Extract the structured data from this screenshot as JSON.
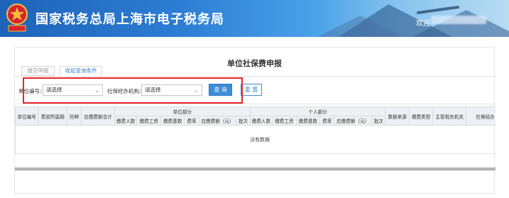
{
  "header": {
    "title": "国家税务总局上海市电子税务局",
    "welcome_text": "欢迎",
    "emblem_icon": "tax-emblem-icon",
    "colors": {
      "header_start": "#1e63b8",
      "header_end": "#b9dcf3"
    }
  },
  "page": {
    "title": "单位社保费申报",
    "tabs": [
      {
        "label": "提交申报",
        "active": false
      },
      {
        "label": "收起查询条件",
        "active": true
      }
    ]
  },
  "filters": {
    "unit_code_label": "单位编号：",
    "unit_code_value": "请选择",
    "agency_label": "社保经办机构：",
    "agency_value": "请选择",
    "search_label": "查 询",
    "reset_label": "重 置",
    "accent_color": "#3c8ed8",
    "highlight_color": "#e8262a"
  },
  "table": {
    "group_unit": "单位部分",
    "group_personal": "个人部分",
    "columns_left": [
      "单位编号",
      "费款所属期",
      "险种",
      "应缴费额合计"
    ],
    "columns_unit": [
      "缴费人数",
      "缴费工资",
      "缴费基数",
      "费率",
      "应缴费额（元）",
      "批次"
    ],
    "columns_personal": [
      "缴费人数",
      "缴费工资",
      "缴费基数",
      "费率",
      "应缴费额（元）",
      "批次"
    ],
    "columns_right": [
      "数据来源",
      "缴费类型",
      "主管税务机关",
      "社保经办"
    ],
    "empty_text": "没有数据"
  }
}
